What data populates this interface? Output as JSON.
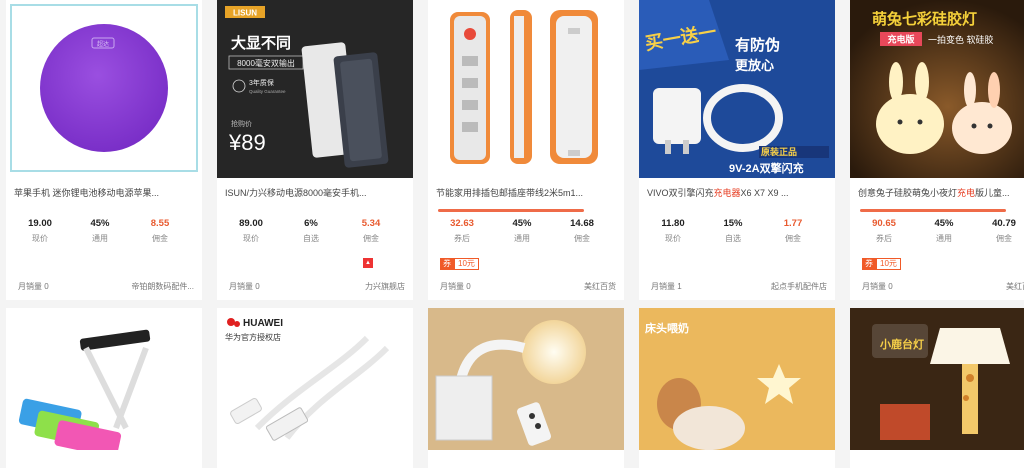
{
  "cards": [
    {
      "title": "苹果手机 迷你锂电池移动电源苹果...",
      "stats": [
        {
          "value": "19.00",
          "label": "现价"
        },
        {
          "value": "45%",
          "label": "通用"
        },
        {
          "value": "8.55",
          "label": "佣金"
        }
      ],
      "sales": "月销量 0",
      "shop": "帝铂朗数码配件...",
      "image": {
        "badge": "超达"
      }
    },
    {
      "title": "ISUN/力兴移动电源8000毫安手机...",
      "stats": [
        {
          "value": "89.00",
          "label": "现价"
        },
        {
          "value": "6%",
          "label": "自选"
        },
        {
          "value": "5.34",
          "label": "佣金"
        }
      ],
      "sales": "月销量 0",
      "shop": "力兴旗舰店",
      "image": {
        "brand": "LISUN",
        "headline": "大显不同",
        "sub": "8000毫安双输出",
        "warranty": "3年质保",
        "quality": "Quality Guarantee",
        "price_label": "抢购价",
        "price": "¥89"
      }
    },
    {
      "title": "节能家用排插包邮插座带线2米5m1...",
      "stats": [
        {
          "value": "32.63",
          "label": "券后"
        },
        {
          "value": "45%",
          "label": "通用"
        },
        {
          "value": "14.68",
          "label": "佣金"
        }
      ],
      "coupon": {
        "tag": "券",
        "value": "10元"
      },
      "progress": 1.0,
      "sales": "月销量 0",
      "shop": "美红百货"
    },
    {
      "title_pre": "VIVO双引擎闪充",
      "title_hl": "充电器",
      "title_post": "X6 X7 X9 ...",
      "stats": [
        {
          "value": "11.80",
          "label": "现价"
        },
        {
          "value": "15%",
          "label": "自选"
        },
        {
          "value": "1.77",
          "label": "佣金"
        }
      ],
      "sales": "月销量 1",
      "shop": "起点手机配件店",
      "image": {
        "promo": "买一送一",
        "slogan1": "有防伪",
        "slogan2": "更放心",
        "brand_tag": "原装正品",
        "spec": "9V-2A双擎闪充"
      }
    },
    {
      "title_pre": "创意兔子硅胶萌兔小夜灯",
      "title_hl": "充电",
      "title_post": "版儿童...",
      "stats": [
        {
          "value": "90.65",
          "label": "券后"
        },
        {
          "value": "45%",
          "label": "通用"
        },
        {
          "value": "40.79",
          "label": "佣金"
        }
      ],
      "coupon": {
        "tag": "券",
        "value": "10元"
      },
      "progress": 1.0,
      "sales": "月销量 0",
      "shop": "美红百货",
      "image": {
        "headline": "萌兔七彩硅胶灯",
        "tag": "充电版",
        "sub": "一拍变色 软硅胶"
      }
    }
  ],
  "row2": [
    {
      "name": "led-desk-lamp"
    },
    {
      "brand": "HUAWEI",
      "store": "华为官方授权店"
    },
    {
      "name": "night-light-remote"
    },
    {
      "caption": "床头喂奶"
    },
    {
      "caption": "小鹿台灯"
    }
  ],
  "colors": {
    "accent": "#ef6b48",
    "price_red": "#e85a2f"
  }
}
